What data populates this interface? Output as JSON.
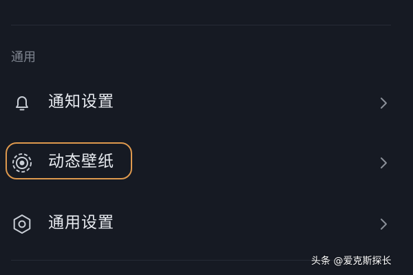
{
  "section": {
    "title": "通用"
  },
  "items": [
    {
      "label": "通知设置",
      "icon": "bell-icon"
    },
    {
      "label": "动态壁纸",
      "icon": "live-wallpaper-icon",
      "highlighted": true
    },
    {
      "label": "通用设置",
      "icon": "gear-icon"
    }
  ],
  "watermark": {
    "text": "头条 @爱克斯探长"
  },
  "colors": {
    "background": "#161a23",
    "text": "#e9ecf1",
    "muted": "#7f8590",
    "highlight": "#e09a4e",
    "chevron": "#8b9099"
  }
}
